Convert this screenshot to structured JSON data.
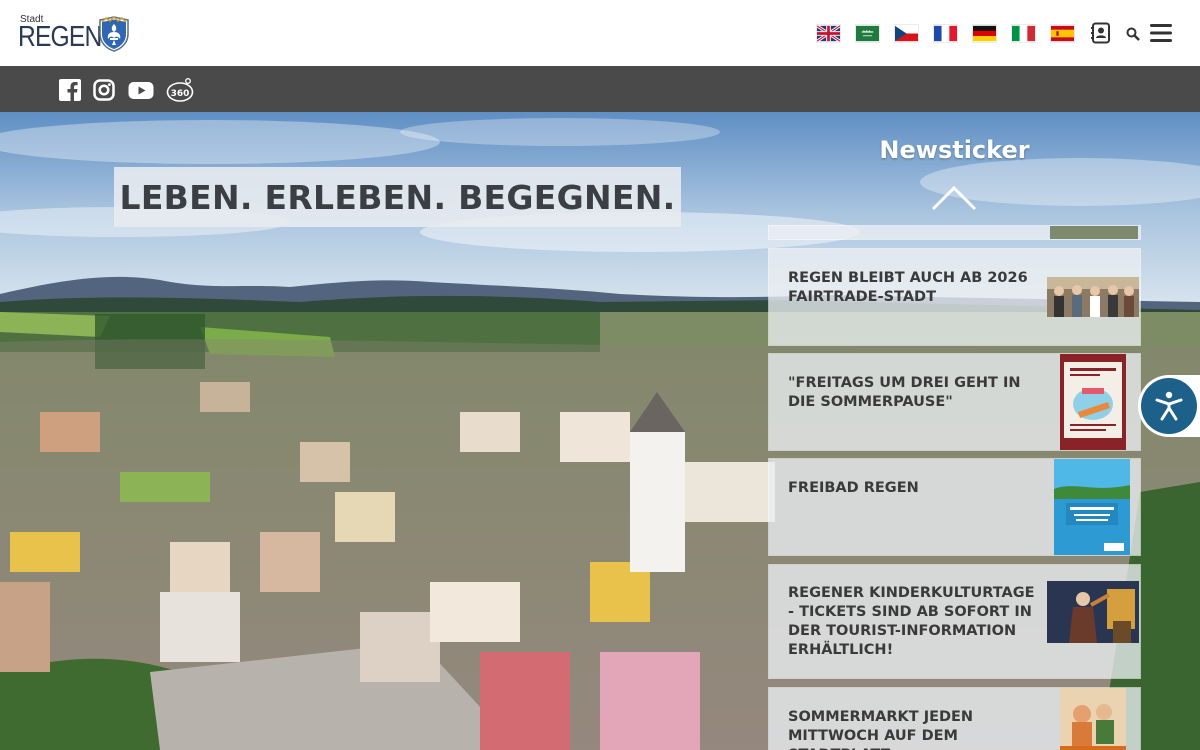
{
  "header": {
    "logo_small": "Stadt",
    "logo_big": "REGEN",
    "languages": [
      "English",
      "العربية",
      "Čeština",
      "Français",
      "Deutsch",
      "Italiano",
      "Español"
    ]
  },
  "social": [
    "facebook-icon",
    "instagram-icon",
    "youtube-icon",
    "360-icon"
  ],
  "hero": {
    "slogan": "LEBEN. ERLEBEN. BEGEGNEN."
  },
  "newsticker": {
    "title": "Newsticker",
    "items": [
      {
        "title": "REGEN BLEIBT AUCH AB 2026 FAIRTRADE-STADT"
      },
      {
        "title": "\"FREITAGS UM DREI GEHT IN DIE SOMMERPAUSE\""
      },
      {
        "title": "FREIBAD REGEN"
      },
      {
        "title": "REGENER KINDERKULTURTAGE - TICKETS SIND AB SOFORT IN DER TOURIST-INFORMATION ERHÄLTLICH!"
      },
      {
        "title": "SOMMERMARKT JEDEN MITTWOCH AUF DEM STADTPLATZ"
      }
    ]
  },
  "colors": {
    "social_bar": "#4a4a4a",
    "accessibility": "#1d6089"
  }
}
